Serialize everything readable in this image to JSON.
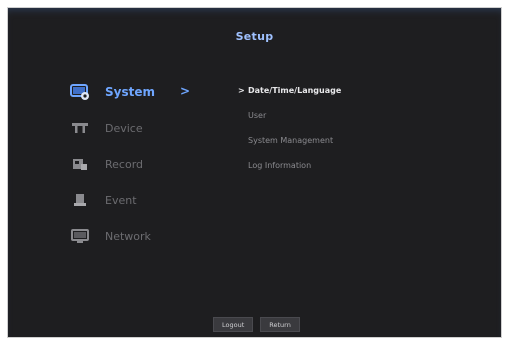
{
  "header": {
    "title": "Setup"
  },
  "menu": {
    "items": [
      {
        "label": "System",
        "icon": "monitor-gear-icon",
        "active": true
      },
      {
        "label": "Device",
        "icon": "camera-bar-icon",
        "active": false
      },
      {
        "label": "Record",
        "icon": "record-icon",
        "active": false
      },
      {
        "label": "Event",
        "icon": "event-icon",
        "active": false
      },
      {
        "label": "Network",
        "icon": "network-icon",
        "active": false
      }
    ],
    "chevron": ">"
  },
  "submenu": {
    "marker": ">",
    "items": [
      {
        "label": "Date/Time/Language",
        "active": true
      },
      {
        "label": "User",
        "active": false
      },
      {
        "label": "System Management",
        "active": false
      },
      {
        "label": "Log Information",
        "active": false
      }
    ]
  },
  "footer": {
    "logout_label": "Logout",
    "return_label": "Return"
  },
  "colors": {
    "accent": "#6fa6ff",
    "background": "#1e1e20"
  }
}
